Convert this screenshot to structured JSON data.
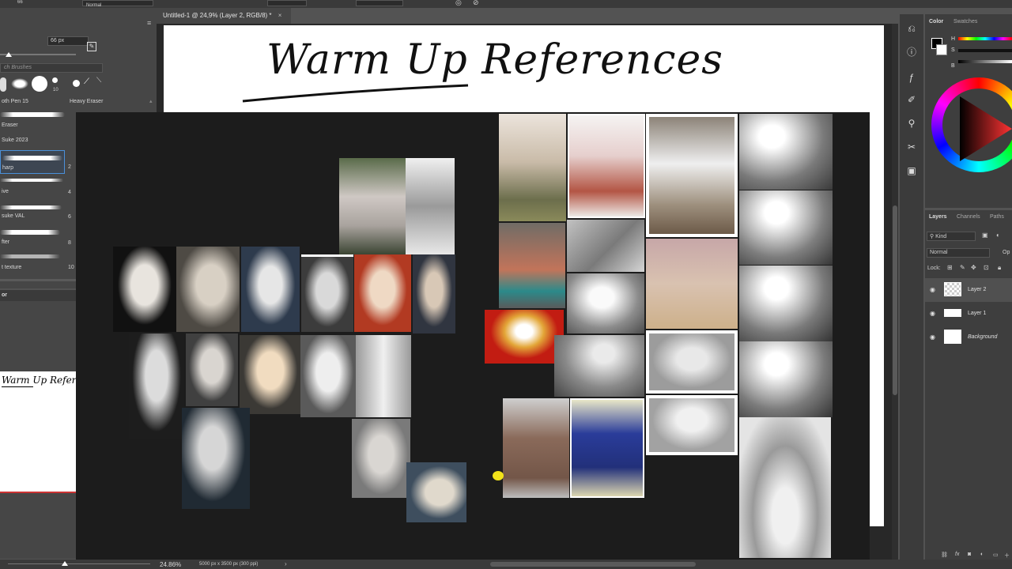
{
  "topbar": {
    "brush_size_small": "66",
    "blend_mode": "Normal"
  },
  "brushes": {
    "size_value": "66 px",
    "search_placeholder": "ch Brushes",
    "preset_num": "10",
    "items": [
      {
        "label": "oth Pen 15",
        "label2": "Heavy Eraser"
      },
      {
        "label": "Eraser"
      },
      {
        "label": "Suke 2023"
      },
      {
        "label": "harp",
        "size": "2"
      },
      {
        "label": "ive",
        "size": "4"
      },
      {
        "label": "suke VAL",
        "size": "6"
      },
      {
        "label": "fter",
        "size": "8"
      },
      {
        "label": "t texture",
        "size": "10"
      }
    ]
  },
  "navigator": {
    "tab_label": "or",
    "thumb_text": "Warm Up  Refer"
  },
  "document": {
    "tab_title": "Untitled-1 @ 24,9% (Layer 2, RGB/8) *",
    "heading": "Warm Up  References"
  },
  "color_panel": {
    "tab_color": "Color",
    "tab_swatches": "Swatches",
    "h": "H",
    "s": "S",
    "b": "B"
  },
  "layers_panel": {
    "tab_layers": "Layers",
    "tab_channels": "Channels",
    "tab_paths": "Paths",
    "kind": "Kind",
    "blend": "Normal",
    "opacity": "Op",
    "lock": "Lock:",
    "layers": [
      {
        "name": "Layer 2"
      },
      {
        "name": "Layer 1"
      },
      {
        "name": "Background"
      }
    ]
  },
  "status": {
    "zoom": "24.86%",
    "doc_info": "5000 px x 3500 px (300 ppi)"
  }
}
